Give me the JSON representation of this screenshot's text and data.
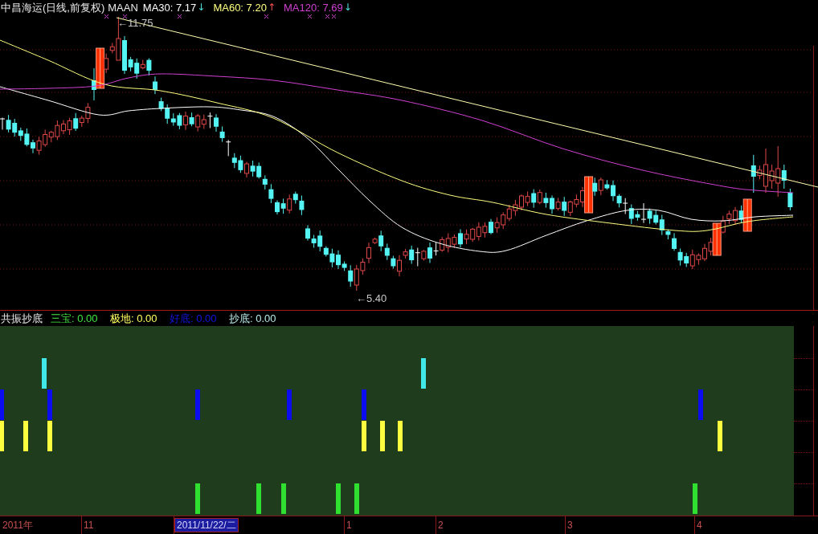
{
  "header": {
    "title": "中昌海运(日线,前复权)",
    "indicator": "MAAN",
    "averages": [
      {
        "label": "MA30: 7.17",
        "arrow": "↓",
        "rising": false,
        "color": "#ffffff"
      },
      {
        "label": "MA60: 7.20",
        "arrow": "↑",
        "rising": true,
        "color": "#ffff80"
      },
      {
        "label": "MA120: 7.69",
        "arrow": "↓",
        "rising": false,
        "color": "#d040d0"
      }
    ]
  },
  "price_chart": {
    "high_label": "←11.75",
    "low_label": "←5.40"
  },
  "signal_panel": {
    "title": "共振抄底",
    "legend": [
      {
        "label": "三宝: 0.00",
        "color": "#40e840"
      },
      {
        "label": "极地: 0.00",
        "color": "#ffff60"
      },
      {
        "label": "好底: 0.00",
        "color": "#1414e0"
      },
      {
        "label": "抄底: 0.00",
        "color": "#b8e8e8"
      }
    ]
  },
  "time_axis": {
    "labels": [
      {
        "text": "2011年",
        "selected": false
      },
      {
        "text": "11",
        "selected": false
      },
      {
        "text": "2011/11/22/二",
        "selected": true
      },
      {
        "text": "1",
        "selected": false
      },
      {
        "text": "2",
        "selected": false
      },
      {
        "text": "3",
        "selected": false
      },
      {
        "text": "4",
        "selected": false
      }
    ]
  }
}
